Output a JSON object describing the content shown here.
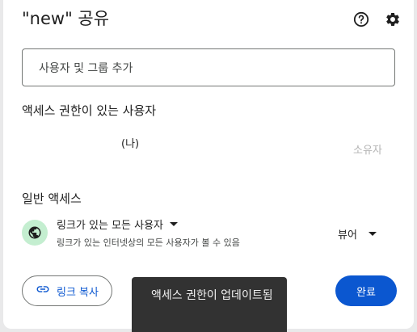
{
  "dialog": {
    "title": "\"new\" 공유",
    "icons": {
      "help": "help-circle-icon",
      "settings": "gear-icon"
    }
  },
  "add_people": {
    "placeholder": "사용자 및 그룹 추가"
  },
  "people_section": {
    "label": "액세스 권한이 있는 사용자",
    "entries": [
      {
        "name": "(나)",
        "role": "소유자"
      }
    ]
  },
  "general_access": {
    "label": "일반 액세스",
    "icon": "globe-icon",
    "selected": "링크가 있는 모든 사용자",
    "description": "링크가 있는 인터넷상의 모든 사용자가 볼 수 있음",
    "role": "뷰어"
  },
  "actions": {
    "copy_link": "링크 복사",
    "done": "완료"
  },
  "toast": {
    "message": "액세스 권한이 업데이트됨"
  },
  "colors": {
    "accent": "#0b57d0",
    "globe_bg": "#c4eed0",
    "toast_bg": "#323232"
  }
}
